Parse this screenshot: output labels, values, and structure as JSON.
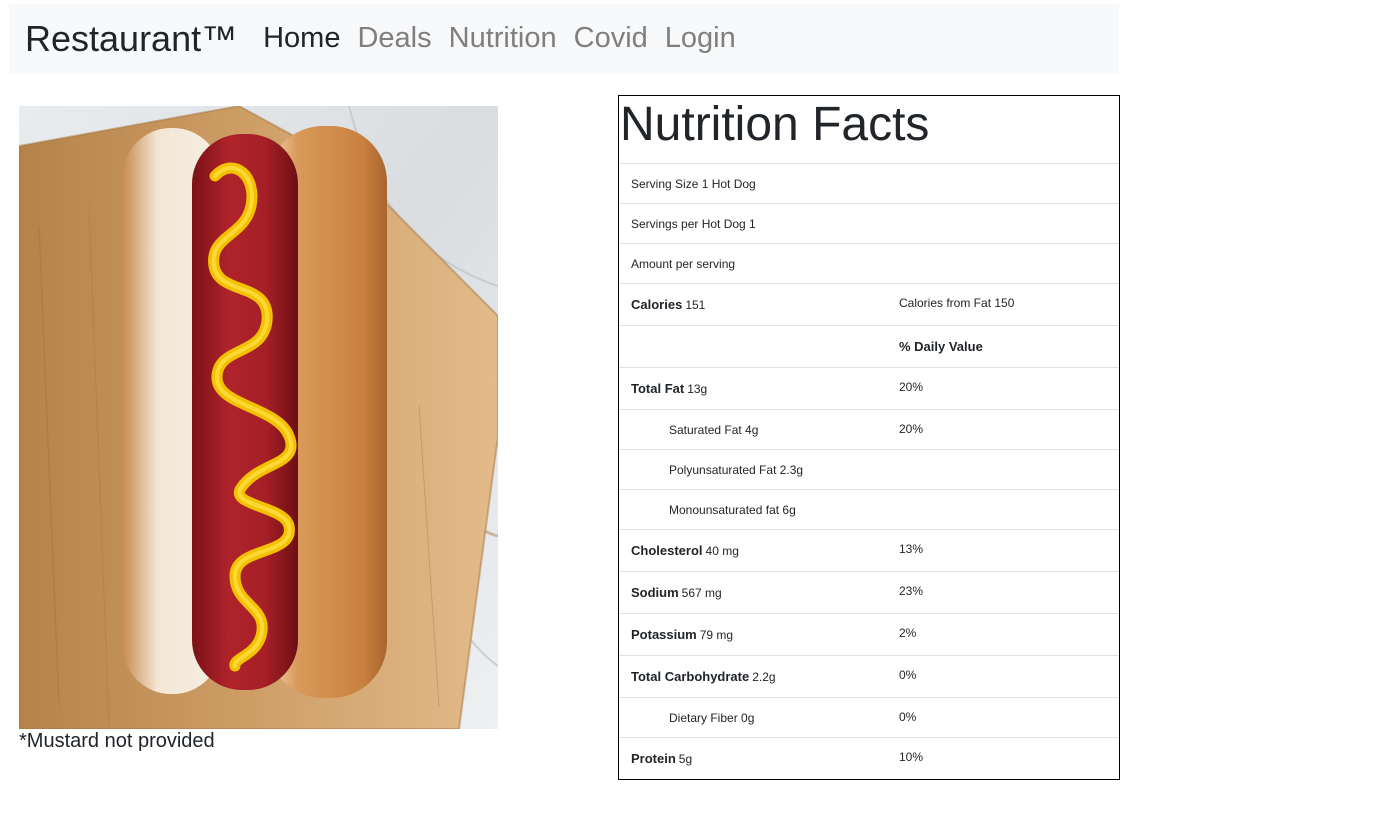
{
  "navbar": {
    "brand": "Restaurant™",
    "links": [
      {
        "label": "Home",
        "active": true
      },
      {
        "label": "Deals",
        "active": false
      },
      {
        "label": "Nutrition",
        "active": false
      },
      {
        "label": "Covid",
        "active": false
      },
      {
        "label": "Login",
        "active": false
      }
    ]
  },
  "product": {
    "image_alt": "hot dog with mustard on a wooden board",
    "caption": "*Mustard not provided"
  },
  "nutrition": {
    "title": "Nutrition Facts",
    "serving_size": "Serving Size 1 Hot Dog",
    "servings_per": "Servings per Hot Dog 1",
    "amount_per_serving": "Amount per serving",
    "calories_label": "Calories",
    "calories_value": "151",
    "calories_from_fat": "Calories from Fat 150",
    "daily_value_header": "% Daily Value",
    "rows": [
      {
        "label": "Total Fat",
        "value": "13g",
        "dv": "20%"
      },
      {
        "label": "Saturated Fat 4g",
        "dv": "20%"
      },
      {
        "label": "Polyunsaturated Fat 2.3g",
        "dv": ""
      },
      {
        "label": "Monounsaturated fat 6g",
        "dv": ""
      },
      {
        "label": "Cholesterol",
        "value": "40 mg",
        "dv": "13%"
      },
      {
        "label": "Sodium",
        "value": "567 mg",
        "dv": "23%"
      },
      {
        "label": "Potassium",
        "value": "79 mg",
        "dv": "2%"
      },
      {
        "label": "Total Carbohydrate",
        "value": "2.2g",
        "dv": "0%"
      },
      {
        "label": "Dietary Fiber 0g",
        "dv": "0%"
      },
      {
        "label": "Protein",
        "value": "5g",
        "dv": "10%"
      }
    ]
  },
  "colors": {
    "navbar_bg": "#f8f9fa",
    "nav_active": "#212529",
    "nav_inactive": "#7f7f7f",
    "table_border": "#000000",
    "row_divider": "#dee2e6"
  }
}
